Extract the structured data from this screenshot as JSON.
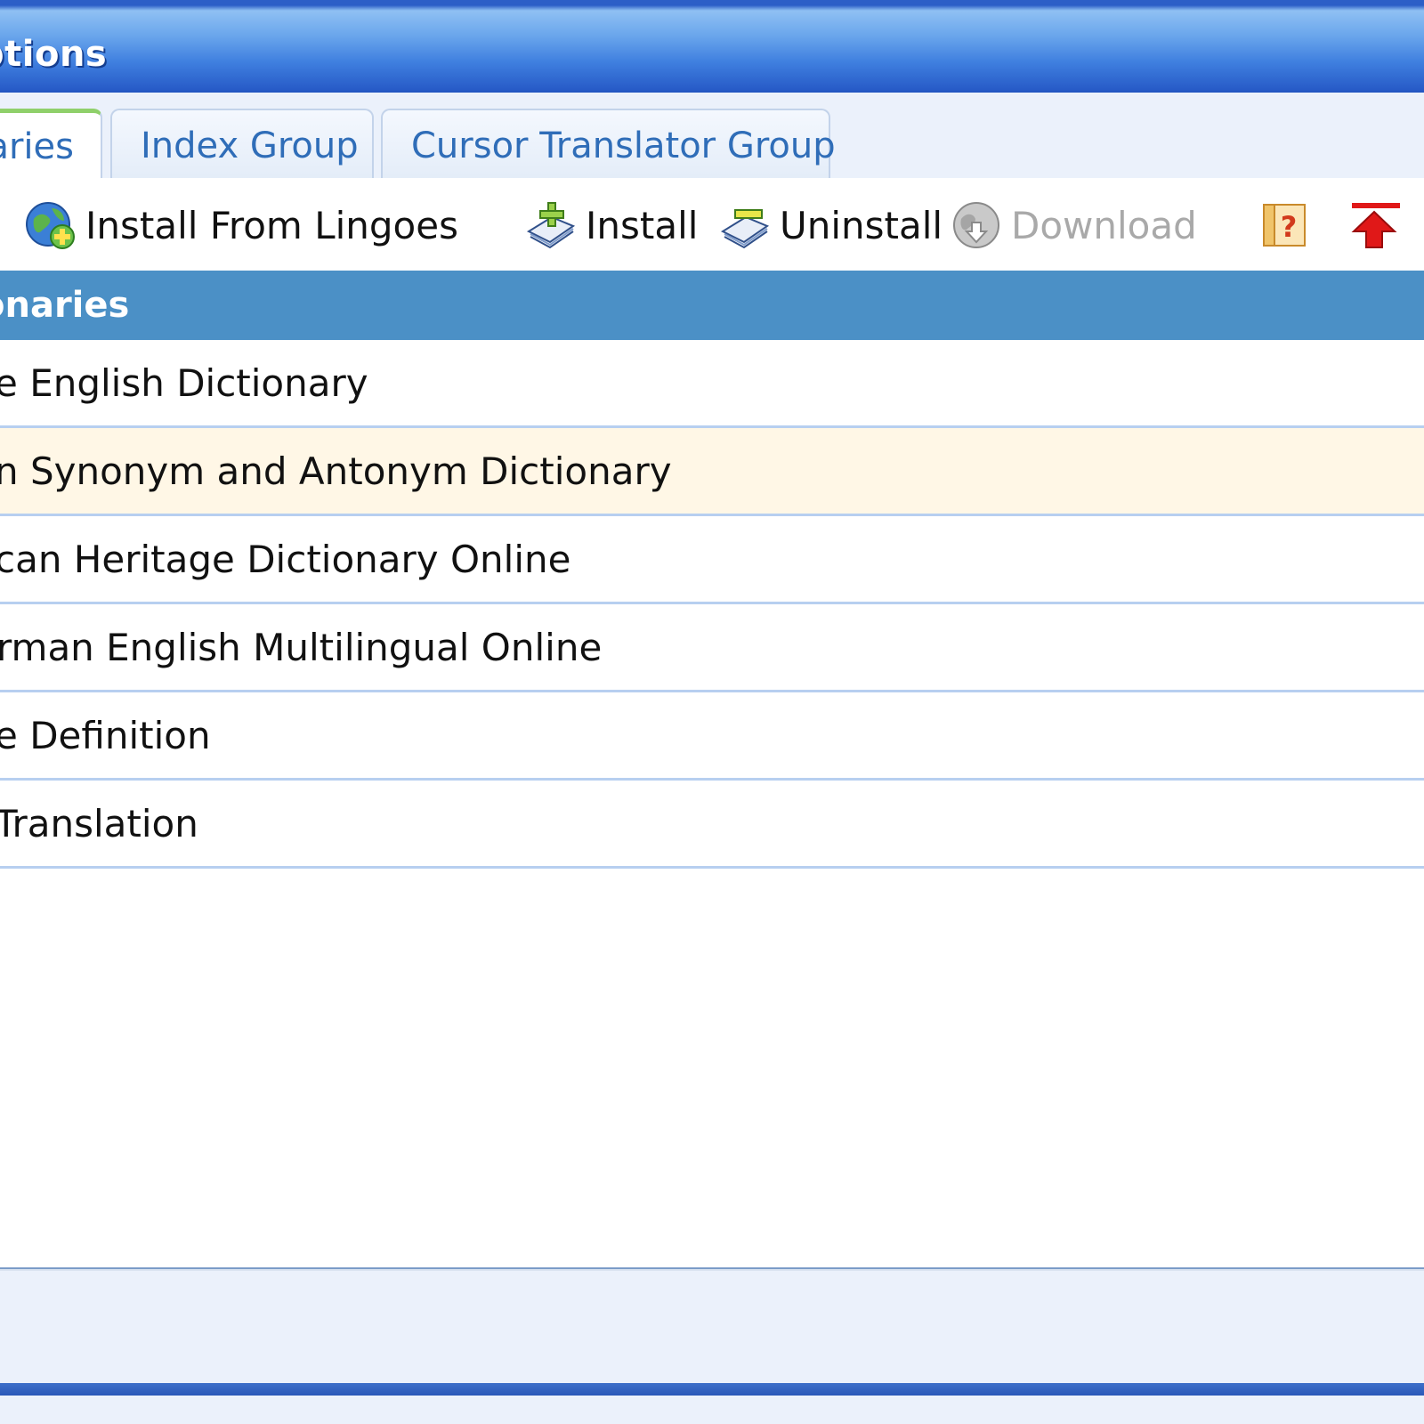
{
  "window": {
    "title": "ptions"
  },
  "tabs": [
    {
      "label": "aries",
      "active": true
    },
    {
      "label": "Index Group",
      "active": false
    },
    {
      "label": "Cursor Translator Group",
      "active": false
    }
  ],
  "toolbar": {
    "install_from_lingoes": "Install From Lingoes",
    "install": "Install",
    "uninstall": "Uninstall",
    "download": "Download"
  },
  "list": {
    "header": "onaries",
    "rows": [
      "e English Dictionary",
      "n Synonym and Antonym Dictionary",
      "can Heritage Dictionary Online",
      "rman English Multilingual Online",
      "e Definition",
      "Translation"
    ],
    "highlighted_row": 1
  },
  "colors": {
    "title_bar": "#3f7fdf",
    "list_header": "#4b90c6",
    "highlight_row": "#fff7e6",
    "tab_text": "#2f6db8",
    "active_tab_accent": "#8fd06a"
  }
}
